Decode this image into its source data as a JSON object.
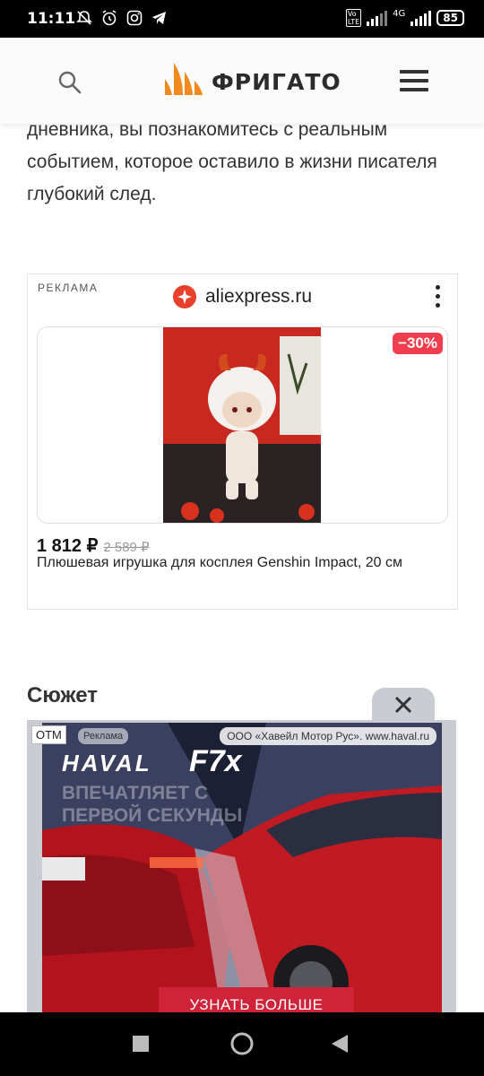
{
  "status_bar": {
    "time": "11:11",
    "network": "4G",
    "battery": "85"
  },
  "header": {
    "logo_text": "ФРИГАТО",
    "icons": {
      "search": "search-icon",
      "menu": "hamburger-menu-icon"
    }
  },
  "article": {
    "paragraph": "дневника, вы познакомитесь с реальным событием, которое оставило в жизни писателя глубокий след."
  },
  "ad": {
    "label": "РЕКЛАМА",
    "brand": "aliexpress.ru",
    "discount": "−30%",
    "price_new": "1 812 ₽",
    "price_old": "2 589 ₽",
    "title": "Плюшевая игрушка для косплея Genshin Impact, 20 см"
  },
  "section": {
    "title": "Сюжет"
  },
  "banner": {
    "otm": "ОТМ",
    "ad_tag": "Реклама",
    "advertiser": "ООО «Хавейл Мотор Рус». www.haval.ru",
    "brand": "HAVAL",
    "model": "F7x",
    "slogan": "ВПЕЧАТЛЯЕТ С ПЕРВОЙ СЕКУНДЫ",
    "cta": "УЗНАТЬ БОЛЬШЕ"
  },
  "colors": {
    "accent_orange": "#f08a1e",
    "badge_red": "#f03e4f",
    "banner_red": "#d0233a"
  }
}
